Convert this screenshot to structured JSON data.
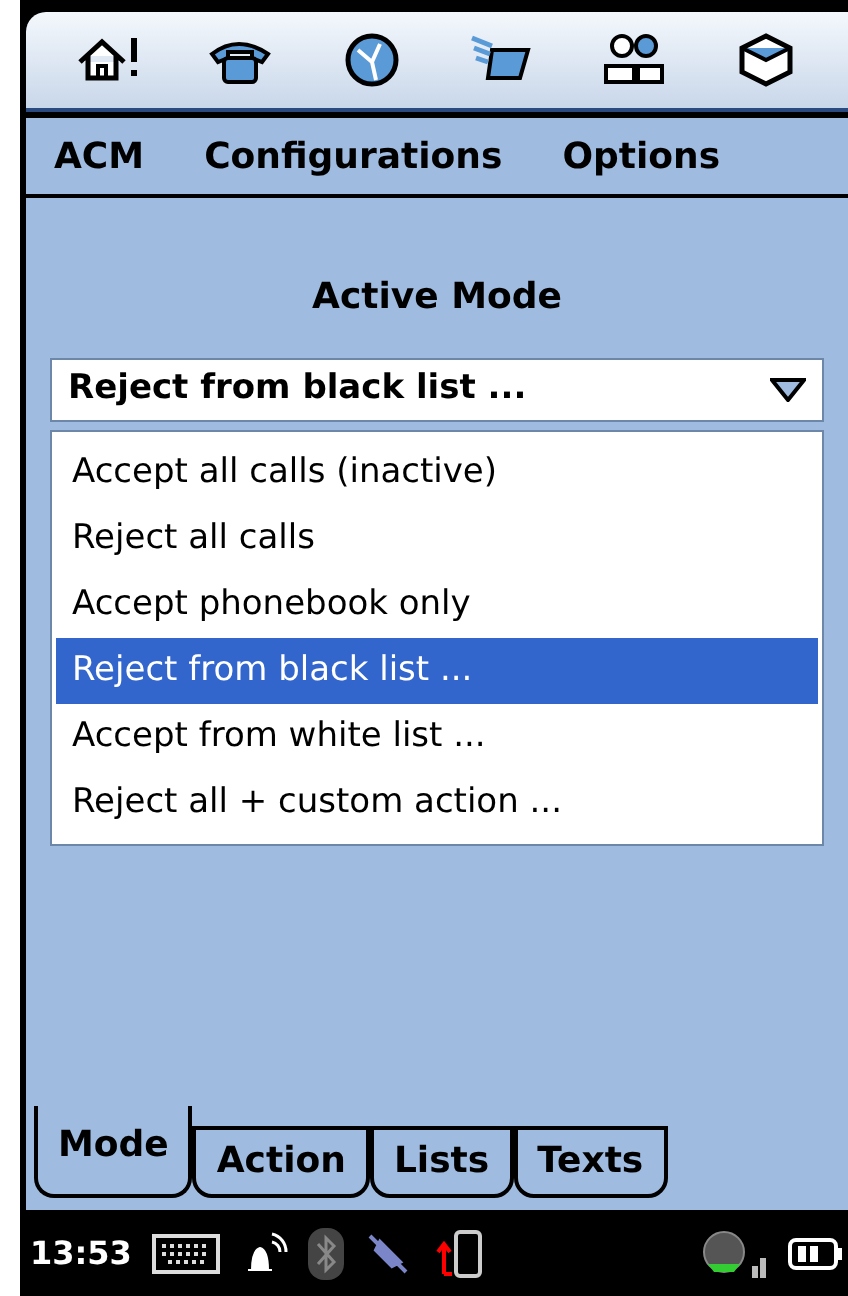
{
  "menu_bar": {
    "items": [
      "ACM",
      "Configurations",
      "Options"
    ]
  },
  "title": "Active Mode",
  "dropdown": {
    "value": "Reject from black list ...",
    "expanded": true,
    "options": [
      {
        "label": "Accept all calls (inactive)",
        "selected": false
      },
      {
        "label": "Reject all calls",
        "selected": false
      },
      {
        "label": "Accept phonebook only",
        "selected": false
      },
      {
        "label": "Reject from black list ...",
        "selected": true
      },
      {
        "label": "Accept from white list ...",
        "selected": false
      },
      {
        "label": "Reject all + custom action ...",
        "selected": false
      }
    ]
  },
  "tabs": [
    {
      "label": "Mode",
      "selected": true
    },
    {
      "label": "Action",
      "selected": false
    },
    {
      "label": "Lists",
      "selected": false
    },
    {
      "label": "Texts",
      "selected": false
    }
  ],
  "status_bar": {
    "time": "13:53"
  }
}
